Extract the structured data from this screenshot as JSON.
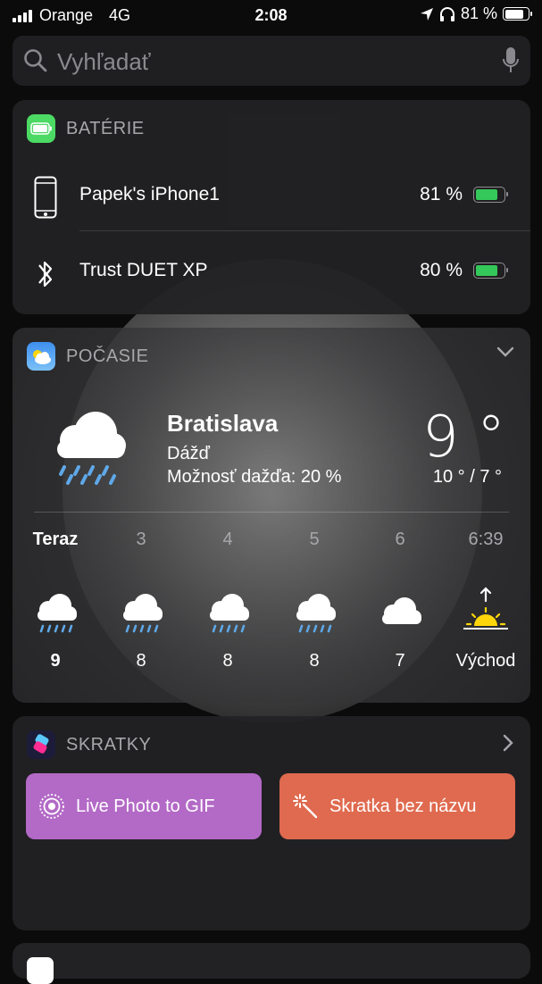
{
  "status_bar": {
    "carrier": "Orange",
    "network": "4G",
    "time": "2:08",
    "battery": "81 %"
  },
  "search": {
    "placeholder": "Vyhľadať"
  },
  "battery_widget": {
    "title": "BATÉRIE",
    "devices": [
      {
        "name": "Papek's iPhone1",
        "percent": "81 %",
        "level": 0.81,
        "icon": "iphone-icon"
      },
      {
        "name": "Trust DUET XP",
        "percent": "80 %",
        "level": 0.8,
        "icon": "bluetooth-icon"
      }
    ]
  },
  "weather_widget": {
    "title": "POČASIE",
    "city": "Bratislava",
    "condition": "Dážď",
    "precipitation": "Možnosť dažďa: 20 %",
    "temperature": "9 °",
    "high_low": "10 ° / 7 °",
    "hourly": [
      {
        "label": "Teraz",
        "temp": "9",
        "icon": "cloud-rain-icon"
      },
      {
        "label": "3",
        "temp": "8",
        "icon": "cloud-rain-icon"
      },
      {
        "label": "4",
        "temp": "8",
        "icon": "cloud-rain-icon"
      },
      {
        "label": "5",
        "temp": "8",
        "icon": "cloud-rain-icon"
      },
      {
        "label": "6",
        "temp": "7",
        "icon": "cloud-icon"
      },
      {
        "label": "6:39",
        "temp": "Východ",
        "icon": "sunrise-icon"
      }
    ]
  },
  "shortcuts_widget": {
    "title": "SKRATKY",
    "buttons": [
      {
        "label": "Live Photo to GIF",
        "color": "#b369c6"
      },
      {
        "label": "Skratka bez názvu",
        "color": "#df6a4f"
      }
    ]
  }
}
